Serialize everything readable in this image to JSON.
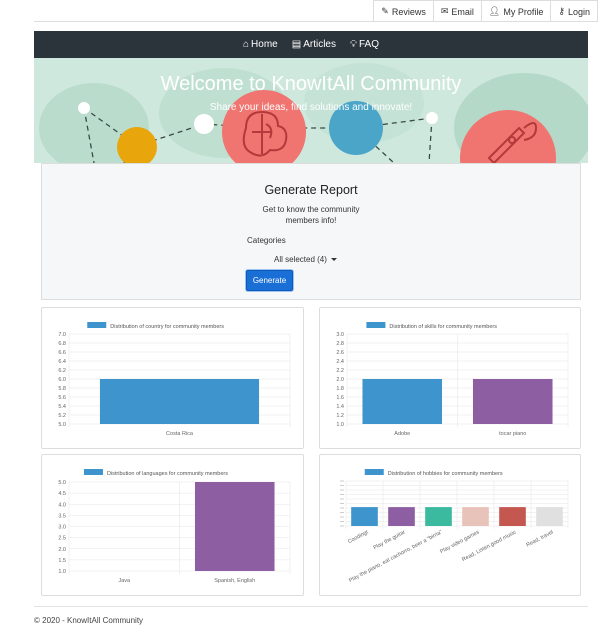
{
  "topnav": {
    "items": [
      {
        "label": "Reviews",
        "icon": "pencil-icon"
      },
      {
        "label": "Email",
        "icon": "envelope-icon"
      },
      {
        "label": "My Profile",
        "icon": "user-icon"
      },
      {
        "label": "Login",
        "icon": "key-icon"
      }
    ]
  },
  "mainnav": {
    "items": [
      {
        "label": "Home",
        "icon": "home-icon"
      },
      {
        "label": "Articles",
        "icon": "document-icon"
      },
      {
        "label": "FAQ",
        "icon": "lightbulb-icon"
      }
    ],
    "background": "#2b333b"
  },
  "hero": {
    "title": "Welcome to KnowItAll Community",
    "subtitle": "Share your ideas, find solutions and innovate!"
  },
  "report": {
    "title": "Generate Report",
    "subtitle": "Get to know the community members info!",
    "categories_label": "Categories",
    "select_value": "All selected (4)",
    "button_label": "Generate",
    "button_color": "#1a6fd6"
  },
  "chart_data": [
    {
      "type": "bar",
      "title": "Distribution of country for community members",
      "categories": [
        "Costa Rica"
      ],
      "values": [
        6.0
      ],
      "ylim": [
        5.0,
        7.0
      ],
      "yticks": [
        "7.0",
        "6.8",
        "6.6",
        "6.4",
        "6.2",
        "6.0",
        "5.8",
        "5.6",
        "5.4",
        "5.2",
        "5.0"
      ],
      "colors": [
        "#3e95cd"
      ],
      "legend": "top"
    },
    {
      "type": "bar",
      "title": "Distribution of skills for community members",
      "categories": [
        "Adobe",
        "tocar piano"
      ],
      "values": [
        2.0,
        2.0
      ],
      "ylim": [
        1.0,
        3.0
      ],
      "yticks": [
        "3.0",
        "2.8",
        "2.6",
        "2.4",
        "2.2",
        "2.0",
        "1.8",
        "1.6",
        "1.4",
        "1.2",
        "1.0"
      ],
      "colors": [
        "#3e95cd",
        "#8e5ea2"
      ],
      "legend": "top"
    },
    {
      "type": "bar",
      "title": "Distribution of languages for community members",
      "categories": [
        "Java",
        "Spanish, English"
      ],
      "values": [
        1.0,
        5.0
      ],
      "ylim": [
        1.0,
        5.0
      ],
      "yticks": [
        "5.0",
        "4.5",
        "4.0",
        "3.5",
        "3.0",
        "2.5",
        "2.0",
        "1.5",
        "1.0"
      ],
      "colors": [
        "#3e95cd",
        "#8e5ea2"
      ],
      "legend": "top"
    },
    {
      "type": "bar",
      "title": "Distribution of hobbies for community members",
      "categories": [
        "Coodingt",
        "Play the guitar",
        "Play the piano, eat cachorro, beer a \"birria\"",
        "Play video games",
        "Read, Listen good music",
        "Read, travel"
      ],
      "values": [
        1,
        1,
        1,
        1,
        1,
        1
      ],
      "colors": [
        "#3e95cd",
        "#8e5ea2",
        "#3cba9f",
        "#e8c3b9",
        "#c45850",
        "#e0e0e0"
      ],
      "legend": "top"
    }
  ],
  "footer": {
    "text": "© 2020 - KnowItAll Community"
  }
}
